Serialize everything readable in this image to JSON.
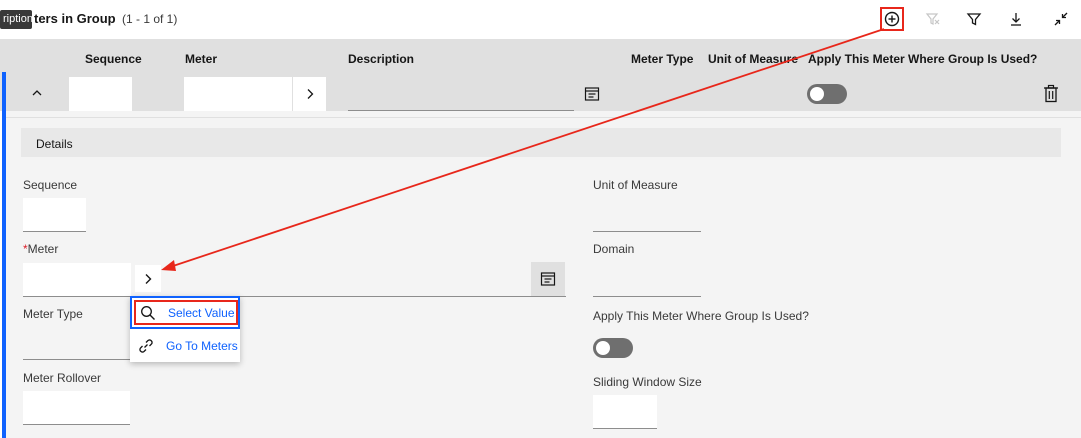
{
  "header": {
    "tooltip": "ription",
    "title": "ters in Group",
    "count": "(1 - 1 of 1)",
    "toolbar": [
      {
        "name": "add-row-button",
        "icon": "plus-circle-icon",
        "highlighted": true
      },
      {
        "name": "clear-filter-button",
        "icon": "filter-remove-icon",
        "disabled": true
      },
      {
        "name": "filter-button",
        "icon": "filter-icon"
      },
      {
        "name": "download-button",
        "icon": "download-icon"
      },
      {
        "name": "collapse-button",
        "icon": "minimize-icon"
      }
    ]
  },
  "columns": {
    "sequence": "Sequence",
    "meter": "Meter",
    "description": "Description",
    "meter_type": "Meter Type",
    "unit_of_measure": "Unit of Measure",
    "apply": "Apply This Meter Where Group Is Used?"
  },
  "row": {
    "sequence_value": "",
    "meter_value": "",
    "description_value": "",
    "apply_toggle": false
  },
  "details": {
    "title": "Details",
    "fields": {
      "sequence": "Sequence",
      "meter": "Meter",
      "meter_required_mark": "*",
      "meter_type": "Meter Type",
      "meter_rollover": "Meter Rollover",
      "unit_of_measure": "Unit of Measure",
      "domain": "Domain",
      "apply": "Apply This Meter Where Group Is Used?",
      "sliding_window": "Sliding Window Size"
    },
    "apply_toggle": false
  },
  "menu": {
    "items": [
      {
        "label": "Select Value",
        "icon": "search-icon",
        "highlighted": true
      },
      {
        "label": "Go To Meters",
        "icon": "link-icon"
      }
    ]
  },
  "colors": {
    "accent": "#0f62fe",
    "highlight": "#e8271b",
    "header_bg": "#e0e0e0",
    "panel_bg": "#f4f4f4"
  }
}
